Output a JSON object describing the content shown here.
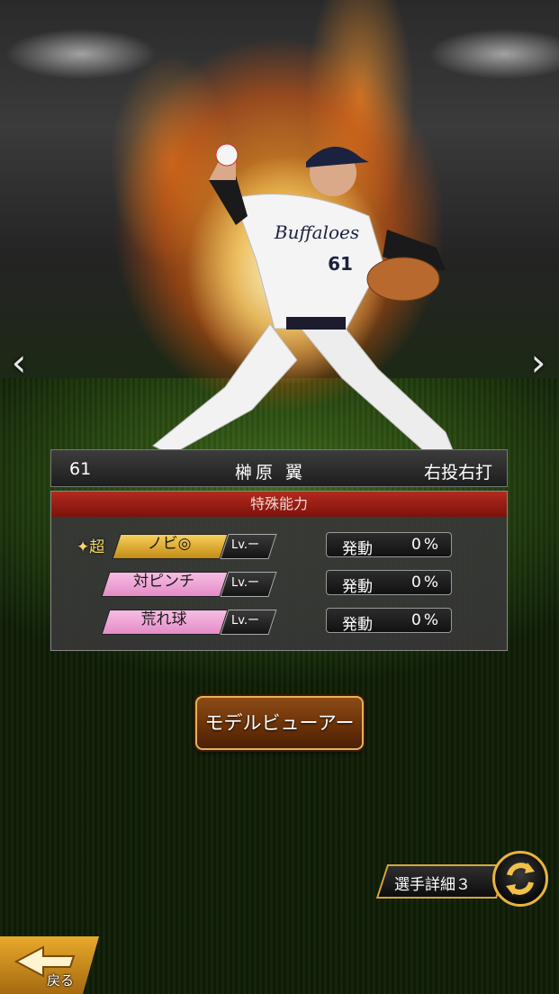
{
  "player": {
    "number": "61",
    "name": "榊原 翼",
    "handedness": "右投右打",
    "jersey_team": "Buffaloes",
    "jersey_number": "61"
  },
  "nav": {
    "prev_icon": "chevron-left-icon",
    "next_icon": "chevron-right-icon",
    "prev": "‹",
    "next": "›"
  },
  "abilities": {
    "title": "特殊能力",
    "items": [
      {
        "prefix": "超",
        "name": "ノビ◎",
        "level": "Lv.ー",
        "activation_label": "発動",
        "activation_value": "0%",
        "color": "#e8b233"
      },
      {
        "prefix": "",
        "name": "対ピンチ",
        "level": "Lv.ー",
        "activation_label": "発動",
        "activation_value": "0%",
        "color": "#f0a6d8"
      },
      {
        "prefix": "",
        "name": "荒れ球",
        "level": "Lv.ー",
        "activation_label": "発動",
        "activation_value": "0%",
        "color": "#f0a6d8"
      }
    ]
  },
  "buttons": {
    "model_viewer": "モデルビューアー",
    "player_detail": "選手詳細３",
    "back": "戻る"
  },
  "colors": {
    "accent_gold": "#e7b43c",
    "header_red": "#b22a1e",
    "button_brown": "#6b3208"
  }
}
